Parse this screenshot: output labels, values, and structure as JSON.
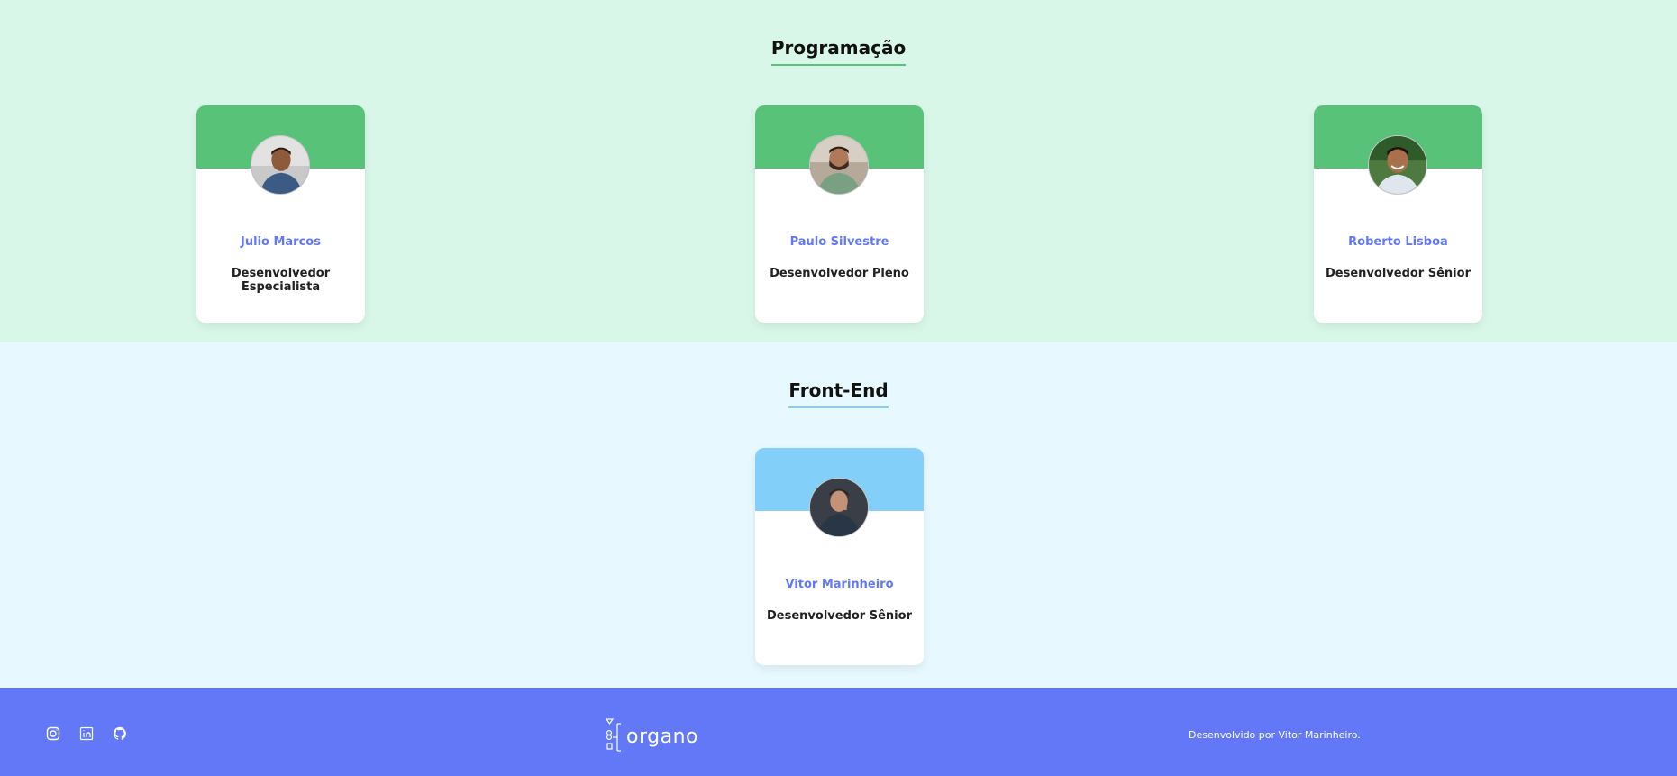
{
  "teams": [
    {
      "title": "Programação",
      "accent": "#57c278",
      "background": "#d9f7e9",
      "members": [
        {
          "name": "Julio Marcos",
          "role": "Desenvolvedor Especialista"
        },
        {
          "name": "Paulo Silvestre",
          "role": "Desenvolvedor Pleno"
        },
        {
          "name": "Roberto Lisboa",
          "role": "Desenvolvedor Sênior"
        }
      ]
    },
    {
      "title": "Front-End",
      "accent": "#82cffa",
      "background": "#e8f8ff",
      "members": [
        {
          "name": "Vitor Marinheiro",
          "role": "Desenvolvedor Sênior"
        }
      ]
    }
  ],
  "footer": {
    "background": "#6278f7",
    "social_icons": [
      "instagram-icon",
      "linkedin-icon",
      "github-icon"
    ],
    "logo_text": "organo",
    "credit": "Desenvolvido por Vitor Marinheiro."
  },
  "colors": {
    "name_text": "#6278f7",
    "role_text": "#212121"
  }
}
